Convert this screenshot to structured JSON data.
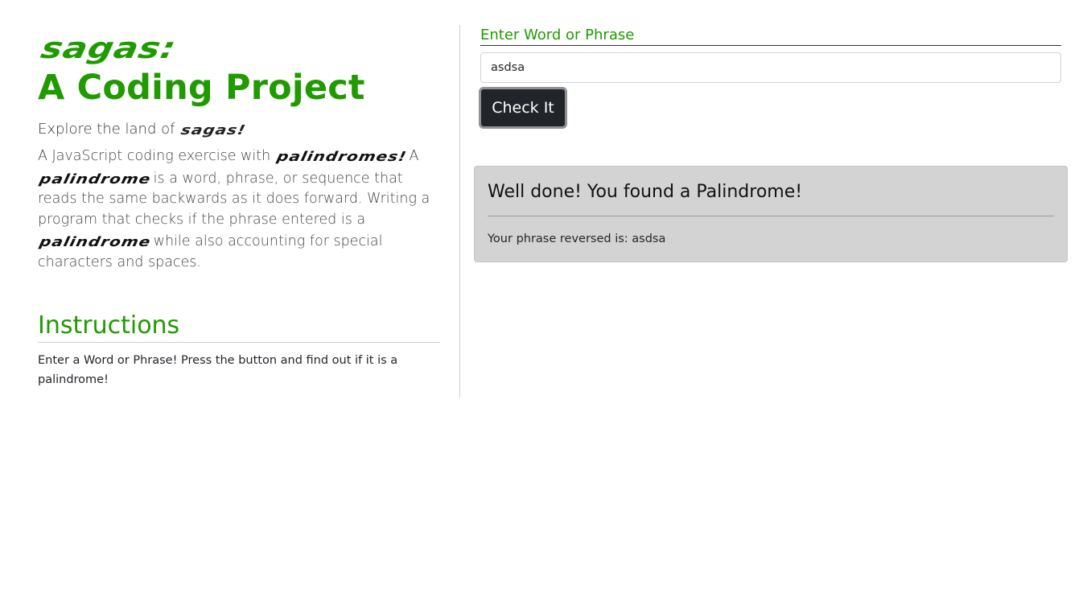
{
  "header": {
    "brand": "sagas:",
    "title": "A Coding Project"
  },
  "intro": {
    "explore_prefix": "Explore the land of ",
    "explore_brand": "sagas!",
    "desc_part1": "A JavaScript coding exercise with ",
    "desc_brand1": "palindromes!",
    "desc_part2": " A ",
    "desc_brand2": "palindrome",
    "desc_part3": " is a word, phrase, or sequence that reads the same backwards as it does forward. Writing a program that checks if the phrase entered is a ",
    "desc_brand3": "palindrome",
    "desc_part4": " while also accounting for special characters and spaces."
  },
  "instructions": {
    "title": "Instructions",
    "text": "Enter a Word or Phrase! Press the button and find out if it is a palindrome!"
  },
  "form": {
    "label": "Enter Word or Phrase",
    "value": "asdsa",
    "button_label": "Check It"
  },
  "result": {
    "title": "Well done! You found a Palindrome!",
    "text": "Your phrase reversed is: asdsa"
  },
  "colors": {
    "accent": "#1f9b00",
    "button_bg": "#212529",
    "result_bg": "#d3d3d3"
  }
}
